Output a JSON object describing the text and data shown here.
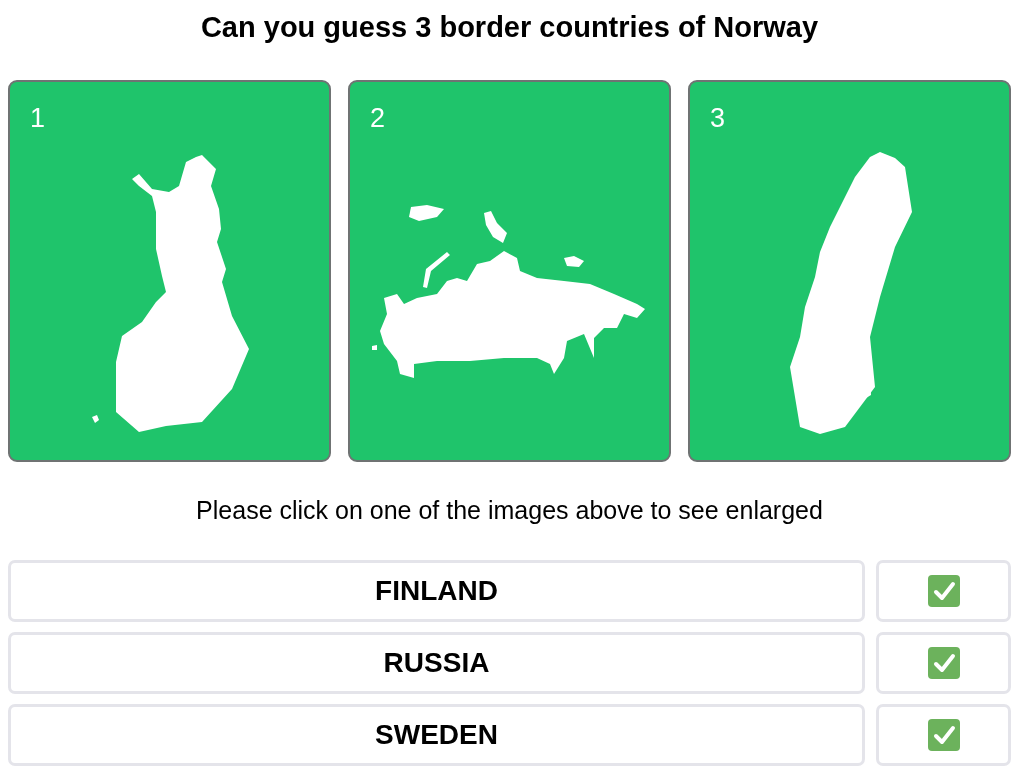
{
  "title": "Can you guess 3 border countries of Norway",
  "cards": [
    {
      "number": "1",
      "kind": "finland"
    },
    {
      "number": "2",
      "kind": "russia"
    },
    {
      "number": "3",
      "kind": "sweden"
    }
  ],
  "instruction": "Please click on one of the images above to see enlarged",
  "answers": [
    {
      "label": "FINLAND",
      "checked": true
    },
    {
      "label": "RUSSIA",
      "checked": true
    },
    {
      "label": "SWEDEN",
      "checked": true
    }
  ]
}
